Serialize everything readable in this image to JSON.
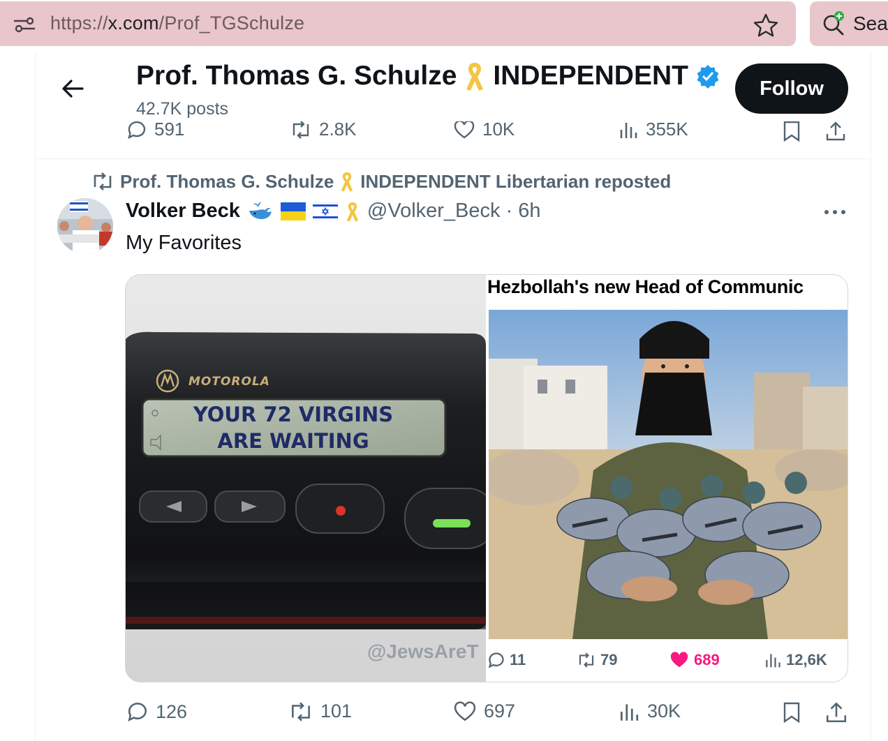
{
  "browser": {
    "url_scheme": "https://",
    "url_host": "x.com",
    "url_path": "/Prof_TGSchulze",
    "search_label": "Sea",
    "icons": [
      "tune-icon",
      "star-icon",
      "search-plus-icon"
    ]
  },
  "header": {
    "name": "Prof. Thomas G. Schulze",
    "name_suffix": "INDEPENDENT",
    "posts_count": "42.7K posts",
    "follow_label": "Follow",
    "verified_color": "#1d9bf0"
  },
  "previous_tweet": {
    "replies": "591",
    "reposts": "2.8K",
    "likes": "10K",
    "views": "355K"
  },
  "repost": {
    "name": "Prof. Thomas G. Schulze",
    "rest": "INDEPENDENT Libertarian reposted"
  },
  "tweet": {
    "author_name": "Volker Beck",
    "handle_time": "@Volker_Beck · 6h",
    "text": "My Favorites",
    "media": {
      "pager_brand": "MOTOROLA",
      "pager_line1": "YOUR 72 VIRGINS",
      "pager_line2": "ARE WAITING",
      "watermark": "@JewsAreT",
      "right_headline": "Hezbollah's new Head of Communic",
      "inner_stats": {
        "replies": "11",
        "reposts": "79",
        "likes": "689",
        "views": "12,6K"
      }
    },
    "stats": {
      "replies": "126",
      "reposts": "101",
      "likes": "697",
      "views": "30K"
    }
  },
  "colors": {
    "url_bar": "#e8c6cc",
    "like_pink": "#f91880",
    "secondary_text": "#536471",
    "ribbon": "#f4c542"
  }
}
